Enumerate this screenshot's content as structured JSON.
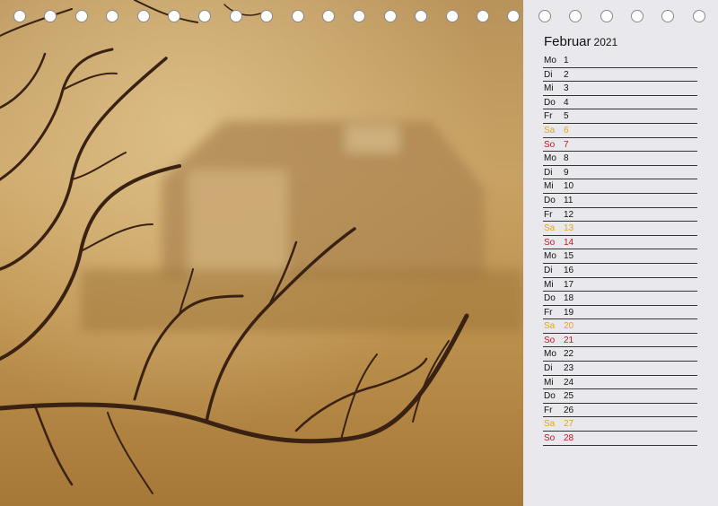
{
  "calendar": {
    "month": "Februar",
    "year": "2021",
    "days": [
      {
        "name": "Mo",
        "num": "1"
      },
      {
        "name": "Di",
        "num": "2"
      },
      {
        "name": "Mi",
        "num": "3"
      },
      {
        "name": "Do",
        "num": "4"
      },
      {
        "name": "Fr",
        "num": "5"
      },
      {
        "name": "Sa",
        "num": "6"
      },
      {
        "name": "So",
        "num": "7"
      },
      {
        "name": "Mo",
        "num": "8"
      },
      {
        "name": "Di",
        "num": "9"
      },
      {
        "name": "Mi",
        "num": "10"
      },
      {
        "name": "Do",
        "num": "11"
      },
      {
        "name": "Fr",
        "num": "12"
      },
      {
        "name": "Sa",
        "num": "13"
      },
      {
        "name": "So",
        "num": "14"
      },
      {
        "name": "Mo",
        "num": "15"
      },
      {
        "name": "Di",
        "num": "16"
      },
      {
        "name": "Mi",
        "num": "17"
      },
      {
        "name": "Do",
        "num": "18"
      },
      {
        "name": "Fr",
        "num": "19"
      },
      {
        "name": "Sa",
        "num": "20"
      },
      {
        "name": "So",
        "num": "21"
      },
      {
        "name": "Mo",
        "num": "22"
      },
      {
        "name": "Di",
        "num": "23"
      },
      {
        "name": "Mi",
        "num": "24"
      },
      {
        "name": "Do",
        "num": "25"
      },
      {
        "name": "Fr",
        "num": "26"
      },
      {
        "name": "Sa",
        "num": "27"
      },
      {
        "name": "So",
        "num": "28"
      }
    ]
  },
  "colors": {
    "saturday": "#e8a21a",
    "sunday": "#c4161c",
    "panel": "#e9e9ed",
    "photo_tone": "#c79a55"
  },
  "binding_rings": 23
}
